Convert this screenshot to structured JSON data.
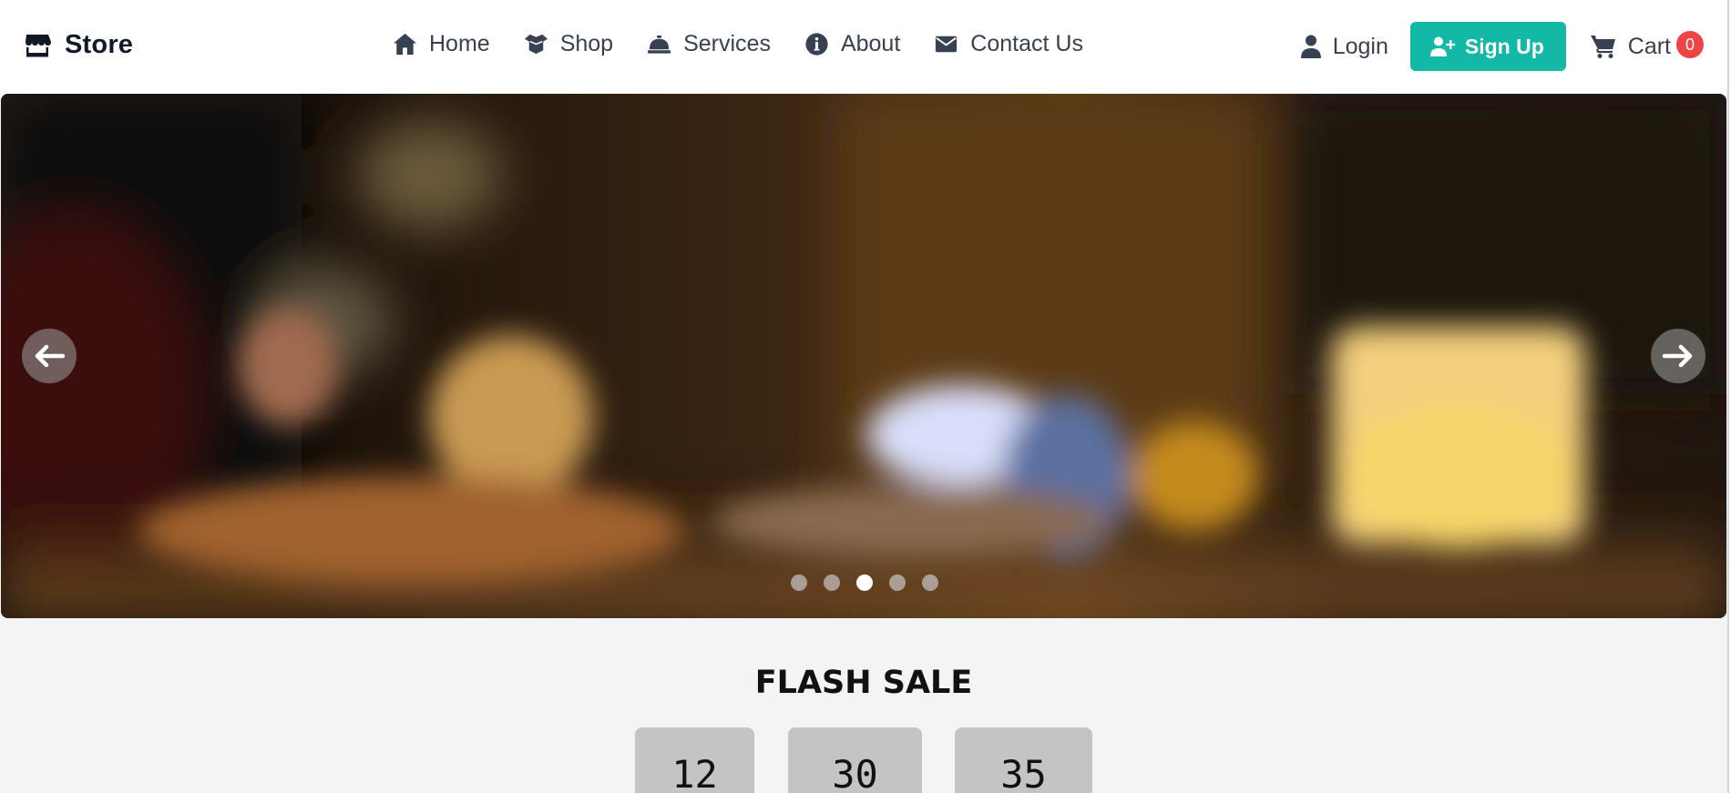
{
  "brand": {
    "name": "Store",
    "icon": "store-icon"
  },
  "nav": {
    "links": [
      {
        "label": "Home",
        "icon": "home-icon"
      },
      {
        "label": "Shop",
        "icon": "box-open-icon"
      },
      {
        "label": "Services",
        "icon": "concierge-bell-icon"
      },
      {
        "label": "About",
        "icon": "info-circle-icon"
      },
      {
        "label": "Contact Us",
        "icon": "envelope-icon"
      }
    ]
  },
  "account": {
    "login_label": "Login",
    "signup_label": "Sign Up",
    "cart_label": "Cart",
    "cart_count": "0"
  },
  "hero": {
    "slide_count": 5,
    "active_slide": 3,
    "prev_icon": "arrow-left-icon",
    "next_icon": "arrow-right-icon"
  },
  "flash_sale": {
    "title": "FLASH SALE",
    "countdown": [
      "12",
      "30",
      "35"
    ]
  },
  "colors": {
    "accent": "#14b8a6",
    "badge": "#ef4444",
    "page_bg": "#f3f4f6",
    "text": "#374151"
  }
}
